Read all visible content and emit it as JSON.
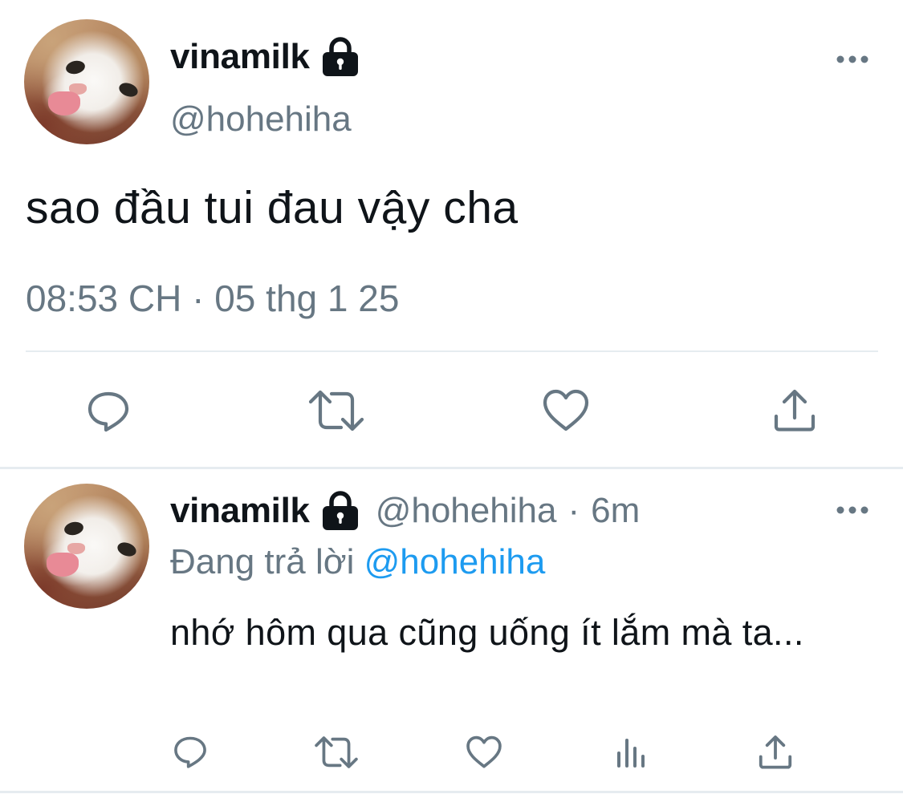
{
  "main_tweet": {
    "display_name": "vinamilk",
    "handle": "@hohehiha",
    "text": "sao đầu tui đau vậy cha",
    "timestamp": "08:53 CH · 05 thg 1 25",
    "protected_icon": "lock-icon",
    "actions": [
      "reply-icon",
      "retweet-icon",
      "like-icon",
      "share-icon"
    ]
  },
  "reply_tweet": {
    "display_name": "vinamilk",
    "handle": "@hohehiha",
    "separator": "·",
    "time": "6m",
    "replying_to_label": "Đang trả lời",
    "replying_to_handle": "@hohehiha",
    "text": "nhớ hôm qua cũng uống ít lắm mà ta...",
    "protected_icon": "lock-icon",
    "actions": [
      "reply-icon",
      "retweet-icon",
      "like-icon",
      "analytics-icon",
      "share-icon"
    ]
  },
  "colors": {
    "text_primary": "#0f1419",
    "text_secondary": "#677783",
    "link": "#1d9bf0",
    "divider": "#e6ecf0"
  }
}
